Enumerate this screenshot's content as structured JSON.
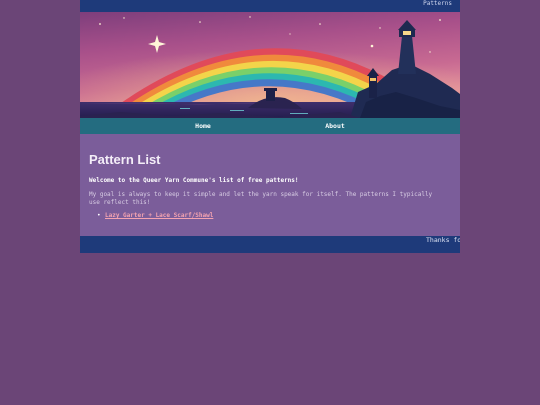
{
  "topbar": {
    "link_label": "Patterns"
  },
  "banner": {
    "image": "rainbow-lighthouse-banner"
  },
  "nav": {
    "items": [
      {
        "label": "Home"
      },
      {
        "label": "About"
      }
    ]
  },
  "main": {
    "title": "Pattern List",
    "welcome": "Welcome to the Queer Yarn Commune's list of free patterns!",
    "intro": "My goal is always to keep it simple and let the yarn speak for itself. The patterns I typically use reflect this!",
    "patterns": [
      {
        "label": "Lazy Garter + Lace Scarf/Shawl"
      }
    ]
  },
  "footer": {
    "text": "Thanks fo"
  },
  "colors": {
    "background": "#6b4577",
    "topbar": "#1e3a7a",
    "navbar": "#246c80",
    "content": "#7b5d9a",
    "link": "#f4a3b0"
  }
}
